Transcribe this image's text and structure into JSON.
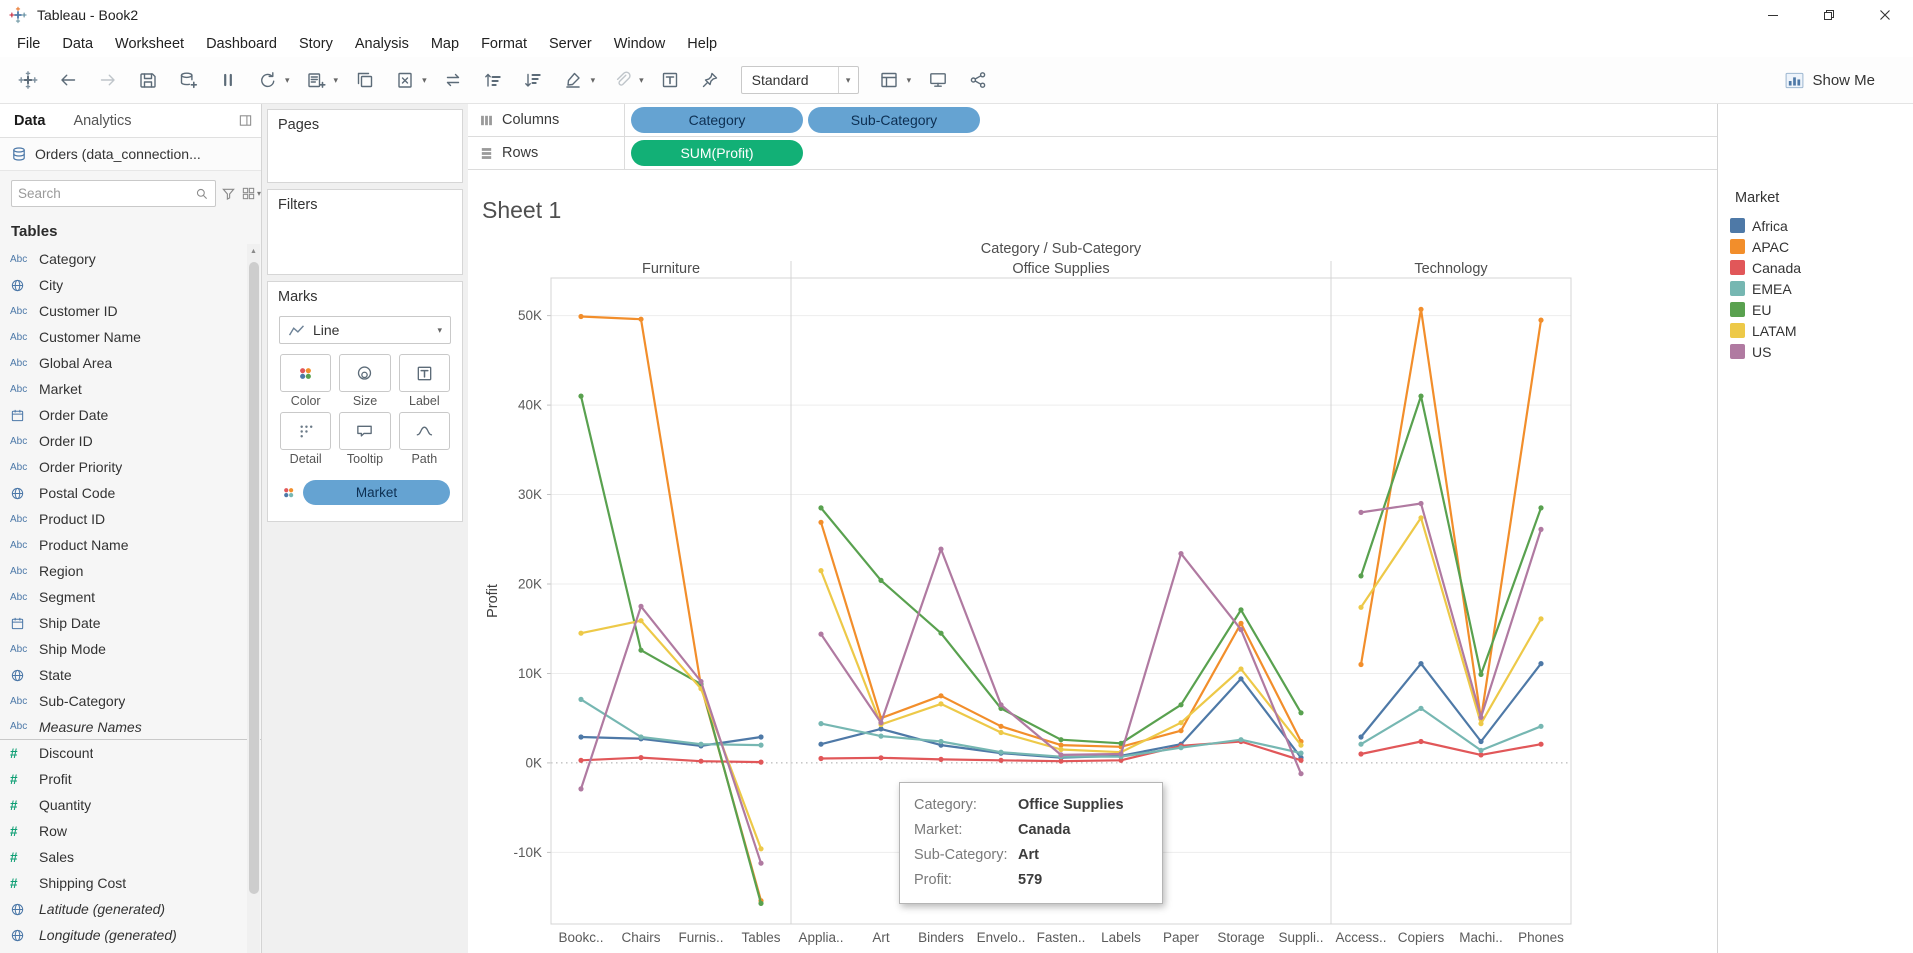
{
  "window": {
    "title": "Tableau - Book2"
  },
  "menu_bar": {
    "items": [
      "File",
      "Data",
      "Worksheet",
      "Dashboard",
      "Story",
      "Analysis",
      "Map",
      "Format",
      "Server",
      "Window",
      "Help"
    ]
  },
  "toolbar": {
    "buttons": [
      {
        "icon": "tableau-logo"
      },
      {
        "icon": "undo"
      },
      {
        "icon": "redo",
        "disabled": true
      },
      {
        "icon": "save"
      },
      {
        "icon": "add-data"
      },
      {
        "icon": "pause-updates"
      },
      {
        "icon": "run-updates",
        "chevron": true
      },
      {
        "icon": "new-worksheet",
        "chevron": true
      },
      {
        "icon": "duplicate"
      },
      {
        "icon": "clear-sheet",
        "chevron": true
      },
      {
        "icon": "swap-rows-columns"
      },
      {
        "icon": "sort-ascending"
      },
      {
        "icon": "sort-descending"
      },
      {
        "icon": "highlight",
        "chevron": true
      },
      {
        "icon": "group-members",
        "chevron": true,
        "disabled": true
      },
      {
        "icon": "show-mark-labels"
      },
      {
        "icon": "fix-axes"
      },
      {
        "icon": "fit",
        "type": "dropdown",
        "value": "Standard"
      },
      {
        "icon": "show-hide-cards",
        "chevron": true
      },
      {
        "icon": "presentation-mode"
      },
      {
        "icon": "share"
      }
    ],
    "show_me_label": "Show Me"
  },
  "sidebar": {
    "tabs": [
      {
        "label": "Data",
        "active": true
      },
      {
        "label": "Analytics",
        "active": false
      }
    ],
    "connection_name": "Orders (data_connection...",
    "search": {
      "placeholder": "Search"
    },
    "section_title": "Tables",
    "fields": [
      {
        "name": "Category",
        "icon": "abc"
      },
      {
        "name": "City",
        "icon": "globe"
      },
      {
        "name": "Customer ID",
        "icon": "abc"
      },
      {
        "name": "Customer Name",
        "icon": "abc"
      },
      {
        "name": "Global Area",
        "icon": "abc"
      },
      {
        "name": "Market",
        "icon": "abc"
      },
      {
        "name": "Order Date",
        "icon": "calendar"
      },
      {
        "name": "Order ID",
        "icon": "abc"
      },
      {
        "name": "Order Priority",
        "icon": "abc"
      },
      {
        "name": "Postal Code",
        "icon": "globe"
      },
      {
        "name": "Product ID",
        "icon": "abc"
      },
      {
        "name": "Product Name",
        "icon": "abc"
      },
      {
        "name": "Region",
        "icon": "abc"
      },
      {
        "name": "Segment",
        "icon": "abc"
      },
      {
        "name": "Ship Date",
        "icon": "calendar"
      },
      {
        "name": "Ship Mode",
        "icon": "abc"
      },
      {
        "name": "State",
        "icon": "globe"
      },
      {
        "name": "Sub-Category",
        "icon": "abc"
      },
      {
        "name": "Measure Names",
        "icon": "abc",
        "italic": true,
        "separator_after": true
      },
      {
        "name": "Discount",
        "icon": "number"
      },
      {
        "name": "Profit",
        "icon": "number"
      },
      {
        "name": "Quantity",
        "icon": "number"
      },
      {
        "name": "Row",
        "icon": "number"
      },
      {
        "name": "Sales",
        "icon": "number"
      },
      {
        "name": "Shipping Cost",
        "icon": "number"
      },
      {
        "name": "Latitude (generated)",
        "icon": "globe",
        "italic": true
      },
      {
        "name": "Longitude (generated)",
        "icon": "globe",
        "italic": true
      }
    ]
  },
  "cards": {
    "pages": {
      "title": "Pages"
    },
    "filters": {
      "title": "Filters"
    },
    "marks": {
      "title": "Marks",
      "mark_type": "Line",
      "buttons": [
        {
          "label": "Color",
          "icon": "color"
        },
        {
          "label": "Size",
          "icon": "size"
        },
        {
          "label": "Label",
          "icon": "label"
        },
        {
          "label": "Detail",
          "icon": "detail"
        },
        {
          "label": "Tooltip",
          "icon": "tooltip"
        },
        {
          "label": "Path",
          "icon": "path"
        }
      ],
      "pills": [
        {
          "label": "Market",
          "type": "dimension",
          "icon": "color-legend"
        }
      ]
    }
  },
  "shelves": {
    "columns": {
      "label": "Columns",
      "pills": [
        {
          "label": "Category",
          "type": "dimension"
        },
        {
          "label": "Sub-Category",
          "type": "dimension"
        }
      ]
    },
    "rows": {
      "label": "Rows",
      "pills": [
        {
          "label": "SUM(Profit)",
          "type": "measure"
        }
      ]
    }
  },
  "sheet": {
    "title": "Sheet 1"
  },
  "tooltip": {
    "rows": [
      {
        "label": "Category:",
        "value": "Office Supplies"
      },
      {
        "label": "Market:",
        "value": "Canada"
      },
      {
        "label": "Sub-Category:",
        "value": "Art"
      },
      {
        "label": "Profit:",
        "value": "579"
      }
    ]
  },
  "legend": {
    "title": "Market",
    "items": [
      {
        "label": "Africa",
        "color": "#4e79a7"
      },
      {
        "label": "APAC",
        "color": "#f28e2b"
      },
      {
        "label": "Canada",
        "color": "#e15759"
      },
      {
        "label": "EMEA",
        "color": "#76b7b2"
      },
      {
        "label": "EU",
        "color": "#59a14f"
      },
      {
        "label": "LATAM",
        "color": "#edc948"
      },
      {
        "label": "US",
        "color": "#b07aa1"
      }
    ]
  },
  "chart_data": {
    "type": "line",
    "title": "Category / Sub-Category",
    "ylabel": "Profit",
    "ylim": [
      -18000,
      54200
    ],
    "grid": true,
    "legend_position": "right",
    "yticks": [
      {
        "value": 50000,
        "label": "50K"
      },
      {
        "value": 40000,
        "label": "40K"
      },
      {
        "value": 30000,
        "label": "30K"
      },
      {
        "value": 20000,
        "label": "20K"
      },
      {
        "value": 10000,
        "label": "10K"
      },
      {
        "value": 0,
        "label": "0K"
      },
      {
        "value": -10000,
        "label": "-10K"
      }
    ],
    "panes": [
      {
        "label": "Furniture",
        "categories": [
          "Bookc..",
          "Chairs",
          "Furnis..",
          "Tables"
        ]
      },
      {
        "label": "Office Supplies",
        "categories": [
          "Applia..",
          "Art",
          "Binders",
          "Envelo..",
          "Fasten..",
          "Labels",
          "Paper",
          "Storage",
          "Suppli.."
        ]
      },
      {
        "label": "Technology",
        "categories": [
          "Access..",
          "Copiers",
          "Machi..",
          "Phones"
        ]
      }
    ],
    "series": [
      {
        "name": "Africa",
        "color": "#4e79a7",
        "values": [
          [
            2900,
            2700,
            1900,
            2900
          ],
          [
            2100,
            3800,
            2000,
            1100,
            600,
            800,
            2100,
            9400,
            600
          ],
          [
            2900,
            11100,
            2400,
            11100
          ]
        ]
      },
      {
        "name": "APAC",
        "color": "#f28e2b",
        "values": [
          [
            49900,
            49600,
            8600,
            -15400
          ],
          [
            26900,
            5000,
            7500,
            4100,
            2000,
            1800,
            3600,
            15600,
            2400
          ],
          [
            11000,
            50700,
            4900,
            49500
          ]
        ]
      },
      {
        "name": "Canada",
        "color": "#e15759",
        "values": [
          [
            300,
            600,
            200,
            100
          ],
          [
            500,
            579,
            400,
            300,
            200,
            300,
            1900,
            2400,
            300
          ],
          [
            1000,
            2400,
            900,
            2100
          ]
        ]
      },
      {
        "name": "EMEA",
        "color": "#76b7b2",
        "values": [
          [
            7100,
            2900,
            2100,
            2000
          ],
          [
            4400,
            3000,
            2400,
            1200,
            700,
            700,
            1700,
            2600,
            1100
          ],
          [
            2100,
            6100,
            1400,
            4100
          ]
        ]
      },
      {
        "name": "EU",
        "color": "#59a14f",
        "values": [
          [
            41000,
            12600,
            8800,
            -15700
          ],
          [
            28500,
            20400,
            14500,
            6100,
            2600,
            2200,
            6500,
            17100,
            5600
          ],
          [
            20900,
            41000,
            9900,
            28500
          ]
        ]
      },
      {
        "name": "LATAM",
        "color": "#edc948",
        "values": [
          [
            14500,
            15900,
            8300,
            -9600
          ],
          [
            21500,
            4300,
            6600,
            3400,
            1500,
            1200,
            4500,
            10500,
            2000
          ],
          [
            17400,
            27400,
            4400,
            16100
          ]
        ]
      },
      {
        "name": "US",
        "color": "#b07aa1",
        "values": [
          [
            -2900,
            17500,
            9100,
            -11200
          ],
          [
            14400,
            4500,
            23900,
            6500,
            900,
            1000,
            23400,
            14900,
            -1200
          ],
          [
            28000,
            29000,
            5100,
            26100
          ]
        ]
      }
    ]
  },
  "colors": {
    "pill_dimension": "#65a3d2",
    "pill_dimension_text": "#0d2f52",
    "pill_measure": "#12b076",
    "accent_blue": "#4c78a8",
    "measure_green": "#0c9e73"
  }
}
